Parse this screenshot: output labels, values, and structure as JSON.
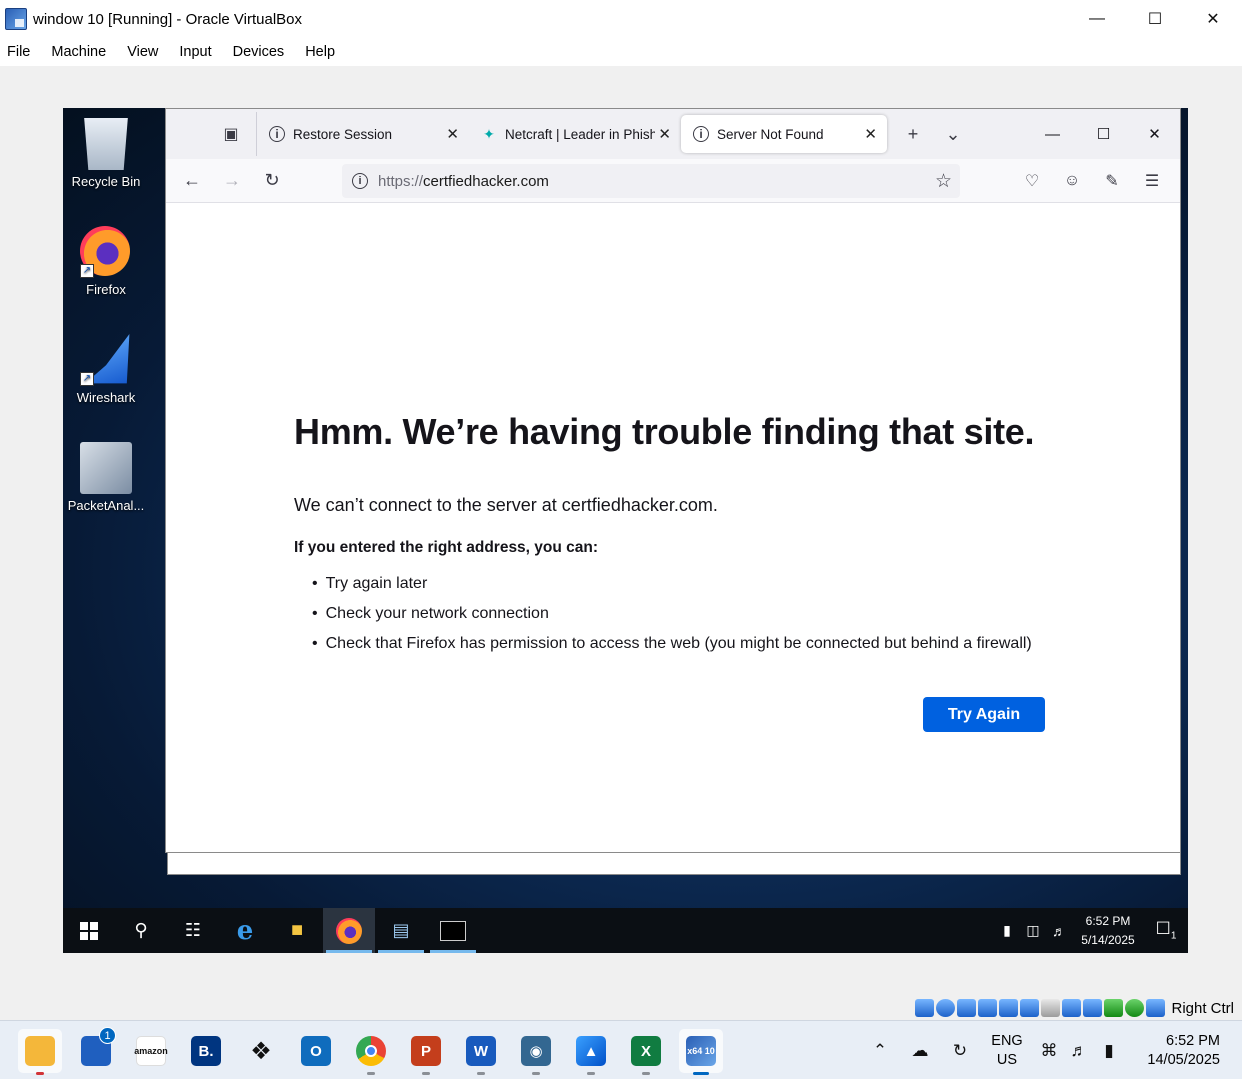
{
  "vbox": {
    "title": "window 10 [Running] - Oracle VirtualBox",
    "menu": [
      "File",
      "Machine",
      "View",
      "Input",
      "Devices",
      "Help"
    ],
    "host_key": "Right Ctrl"
  },
  "desktop": {
    "icons": [
      {
        "label": "Recycle Bin",
        "icon": "recycle-bin-icon"
      },
      {
        "label": "Firefox",
        "icon": "firefox-icon"
      },
      {
        "label": "Wireshark",
        "icon": "wireshark-icon"
      },
      {
        "label": "PacketAnal...",
        "icon": "packet-analyzer-icon"
      }
    ]
  },
  "firefox": {
    "tabs": [
      {
        "label": "Restore Session",
        "active": false
      },
      {
        "label": "Netcraft | Leader in Phishi",
        "active": false
      },
      {
        "label": "Server Not Found",
        "active": true
      }
    ],
    "url_scheme": "https://",
    "url_host": "certfiedhacker.com",
    "error": {
      "title": "Hmm. We’re having trouble finding that site.",
      "description": "We can’t connect to the server at certfiedhacker.com.",
      "subheading": "If you entered the right address, you can:",
      "suggestions": [
        "Try again later",
        "Check your network connection",
        "Check that Firefox has permission to access the web (you might be connected but behind a firewall)"
      ],
      "button": "Try Again"
    }
  },
  "guest_taskbar": {
    "time": "6:52 PM",
    "date": "5/14/2025",
    "notification_count": "1"
  },
  "host_taskbar": {
    "store_badge": "1",
    "apps": [
      "File Explorer",
      "Microsoft Store",
      "Amazon",
      "Booking.com",
      "Dropbox",
      "Outlook",
      "Chrome",
      "PowerPoint",
      "Word",
      "PostgreSQL",
      "Photos",
      "Excel",
      "VirtualBox"
    ],
    "amazon_text": "amazon",
    "booking_text": "B.",
    "outlook_text": "O",
    "ppt_text": "P",
    "word_text": "W",
    "excel_text": "X",
    "vbox_text": "x64 10",
    "lang": "ENG",
    "region": "US",
    "time": "6:52 PM",
    "date": "14/05/2025"
  },
  "colors": {
    "accent_button": "#0061e0",
    "host_accent": "#0067c0",
    "guest_taskbar": "#0b0f14"
  }
}
